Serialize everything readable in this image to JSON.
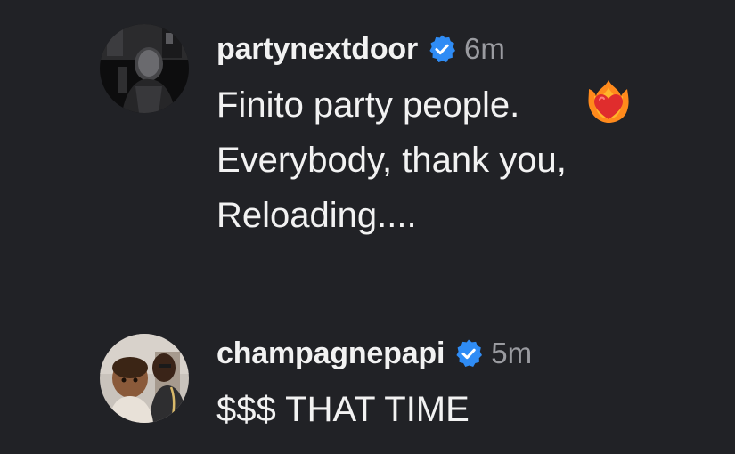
{
  "comments": [
    {
      "username": "partynextdoor",
      "verified": true,
      "time": "6m",
      "lines": [
        "Finito party people.",
        "Everybody, thank you,",
        "Reloading...."
      ],
      "emoji": "heart-on-fire-icon"
    },
    {
      "username": "champagnepapi",
      "verified": true,
      "time": "5m",
      "lines": [
        "$$$ THAT TIME"
      ]
    }
  ],
  "colors": {
    "background": "#212226",
    "text": "#f2f2f2",
    "timestamp": "#9a9ba0",
    "verified_badge": "#2f8cf5"
  }
}
